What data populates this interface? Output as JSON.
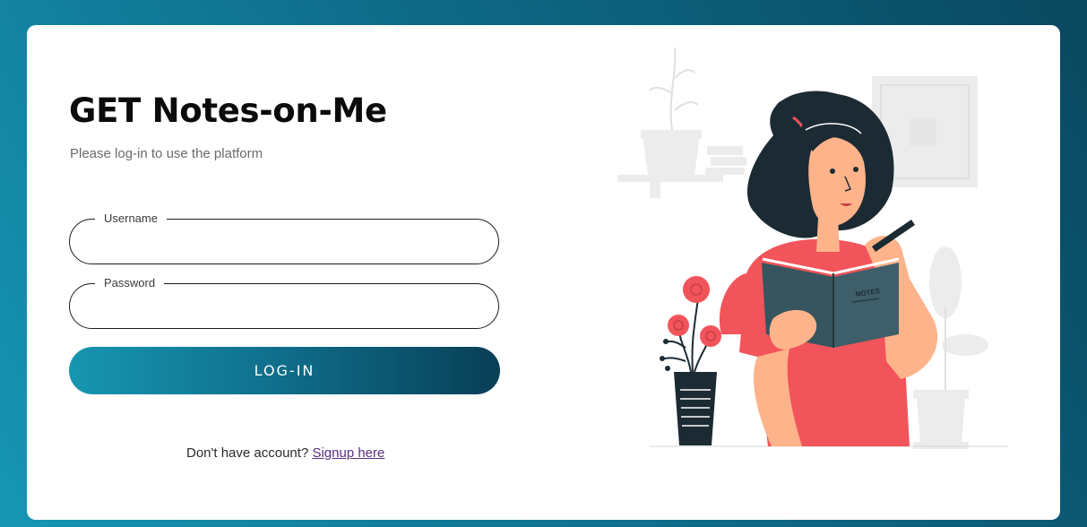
{
  "page": {
    "title": "GET Notes-on-Me",
    "subtitle": "Please log-in to use the platform"
  },
  "form": {
    "username_label": "Username",
    "username_value": "",
    "password_label": "Password",
    "password_value": "",
    "login_button": "LOG-IN"
  },
  "signup": {
    "prompt": "Don't have account?",
    "link_text": "Signup here"
  },
  "illustration": {
    "name": "woman-reading-notes-illustration",
    "book_label": "NOTES"
  },
  "colors": {
    "background_gradient": [
      "#1696b3",
      "#09485f"
    ],
    "accent": "#f2545b",
    "dark": "#1c2b33",
    "book": "#37555e",
    "link": "#5a2d82"
  }
}
